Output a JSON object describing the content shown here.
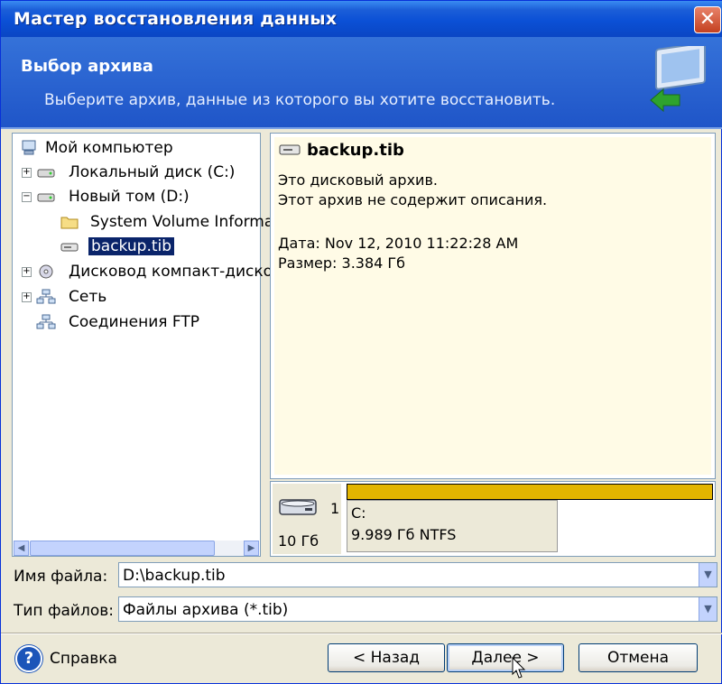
{
  "window": {
    "title": "Мастер восстановления данных",
    "close_glyph": "✕"
  },
  "banner": {
    "heading": "Выбор архива",
    "subheading": "Выберите архив, данные из которого вы хотите восстановить.",
    "icon": "restore-wizard-icon"
  },
  "tree": {
    "items": [
      {
        "label": "Мой компьютер",
        "icon": "my-computer-icon"
      },
      {
        "label": "Локальный диск (C:)",
        "icon": "hard-drive-icon",
        "expander": "+"
      },
      {
        "label": "Новый том (D:)",
        "icon": "hard-drive-icon",
        "expander": "−"
      },
      {
        "label": "System Volume Informa",
        "icon": "folder-icon"
      },
      {
        "label": "backup.tib",
        "icon": "archive-icon",
        "selected": true
      },
      {
        "label": "Дисковод компакт-диско",
        "icon": "cd-drive-icon",
        "expander": "+"
      },
      {
        "label": "Сеть",
        "icon": "network-icon",
        "expander": "+"
      },
      {
        "label": "Соединения FTP",
        "icon": "ftp-icon"
      }
    ]
  },
  "info": {
    "title": "backup.tib",
    "line1": "Это дисковый архив.",
    "line2": "Этот архив не содержит описания.",
    "date": "Дата: Nov 12, 2010 11:22:28 AM",
    "size": "Размер: 3.384 Гб"
  },
  "disk": {
    "size": "10 Гб",
    "number": "1",
    "partition_name": "C:",
    "partition_info": "9.989 Гб  NTFS",
    "bar_color": "#e3b500"
  },
  "fields": {
    "filename_label": "Имя файла:",
    "filename_value": "D:\\backup.tib",
    "filetype_label": "Тип файлов:",
    "filetype_value": "Файлы архива (*.tib)"
  },
  "buttons": {
    "help": "Справка",
    "back": "< Назад",
    "next": "Далее >",
    "cancel": "Отмена"
  }
}
